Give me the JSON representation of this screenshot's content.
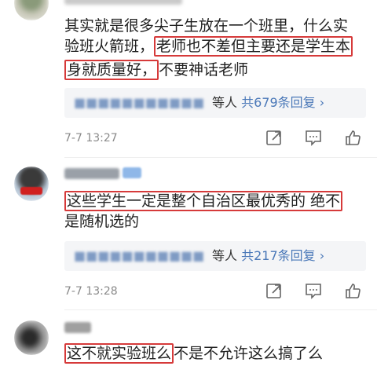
{
  "comments": [
    {
      "lines": [
        [
          {
            "t": "其实就是很多尖子生放在一个班里，什么实"
          }
        ],
        [
          {
            "t": "验班火箭班，"
          },
          {
            "t": "老师也不差但主要还是学生本",
            "hl": true
          }
        ],
        [
          {
            "t": "身就质量好，",
            "hl": true
          },
          {
            "t": "不要神话老师"
          }
        ]
      ],
      "reply_suffix": "等人 ",
      "reply_count": "共679条回复 ›",
      "time": "7-7 13:27"
    },
    {
      "lines": [
        [
          {
            "t": "这些学生一定是整个自治区最优秀的 绝不",
            "hl": true
          }
        ],
        [
          {
            "t": "是随机选的"
          }
        ]
      ],
      "reply_suffix": "等人 ",
      "reply_count": "共217条回复 ›",
      "time": "7-7 13:28"
    },
    {
      "lines": [
        [
          {
            "t": "这不就实验班么",
            "hl": true
          },
          {
            "t": "不是不允许这么搞了么"
          }
        ]
      ]
    }
  ],
  "icons": [
    "share-icon",
    "comment-icon",
    "like-icon"
  ]
}
